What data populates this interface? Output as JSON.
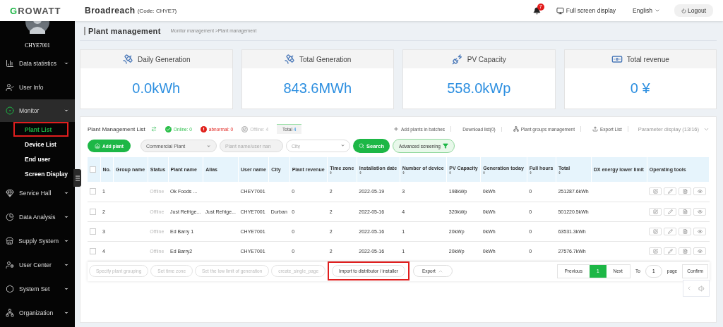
{
  "header": {
    "logo": "GROWATT",
    "org_name": "Broadreach",
    "org_code": "(Code:  CHYE7)",
    "notifications": "7",
    "fullscreen": "Full screen display",
    "language": "English",
    "logout": "Logout"
  },
  "sidebar": {
    "username": "CHYE7001",
    "items": [
      {
        "label": "Data statistics",
        "kind": "group",
        "expanded": false
      },
      {
        "label": "User Info",
        "kind": "link",
        "expanded": false
      },
      {
        "label": "Monitor",
        "kind": "group",
        "expanded": true,
        "children": [
          {
            "label": "Plant List",
            "selected": true,
            "highlighted": true
          },
          {
            "label": "Device List",
            "selected": false,
            "highlighted": false
          },
          {
            "label": "End user",
            "selected": false,
            "highlighted": false
          },
          {
            "label": "Screen Display",
            "selected": false,
            "highlighted": false
          }
        ]
      },
      {
        "label": "Service Hall",
        "kind": "group",
        "expanded": false
      },
      {
        "label": "Data Analysis",
        "kind": "group",
        "expanded": false
      },
      {
        "label": "Supply System",
        "kind": "group",
        "expanded": false
      },
      {
        "label": "User Center",
        "kind": "group",
        "expanded": false
      },
      {
        "label": "System Set",
        "kind": "group",
        "expanded": false
      },
      {
        "label": "Organization",
        "kind": "group",
        "expanded": false
      }
    ]
  },
  "breadcrumb": {
    "title": "Plant management",
    "path": "Monitor management >Plant management"
  },
  "stats": [
    {
      "label": "Daily Generation",
      "value": "0.0kWh"
    },
    {
      "label": "Total Generation",
      "value": "843.6MWh"
    },
    {
      "label": "PV Capacity",
      "value": "558.0kWp"
    },
    {
      "label": "Total revenue",
      "value": "0 ¥"
    }
  ],
  "list": {
    "title": "Plant Management List",
    "statuses": [
      {
        "label": "Online: 0",
        "color": "#2bbf4a"
      },
      {
        "label": "abnormal: 0",
        "color": "#e0201b"
      },
      {
        "label": "Offline: 4",
        "color": "#bdbdbd"
      }
    ],
    "total": {
      "label": "Total",
      "count": "4",
      "selected": true
    },
    "actions": [
      "Add plants in batches",
      "Download list(0)",
      "Plant groups management",
      "Export List"
    ],
    "parameter_display": "Parameter display  (13/16)"
  },
  "filters": {
    "add_button": "Add plant",
    "plant_type": "Commercial Plant",
    "search_placeholder": "Plant name/user nan",
    "city_placeholder": "City",
    "search_button": "Search",
    "advanced_button": "Advanced screening"
  },
  "table": {
    "select_all_checked": false,
    "columns": [
      {
        "label": "No.",
        "kind": "text",
        "sortable": false
      },
      {
        "label": "Group name",
        "kind": "text",
        "sortable": false
      },
      {
        "label": "Status",
        "kind": "status",
        "sortable": false
      },
      {
        "label": "Plant name",
        "kind": "text",
        "sortable": false
      },
      {
        "label": "Alias",
        "kind": "text",
        "sortable": false
      },
      {
        "label": "User name",
        "kind": "text",
        "sortable": false
      },
      {
        "label": "City",
        "kind": "text",
        "sortable": false
      },
      {
        "label": "Plant revenue",
        "kind": "text",
        "sortable": false
      },
      {
        "label": "Time zone",
        "kind": "text",
        "sortable": true
      },
      {
        "label": "Installation date",
        "kind": "text",
        "sortable": true
      },
      {
        "label": "Number of device",
        "kind": "text",
        "sortable": true
      },
      {
        "label": "PV Capacity",
        "kind": "text",
        "sortable": true
      },
      {
        "label": "Generation today",
        "kind": "text",
        "sortable": true
      },
      {
        "label": "Full hours",
        "kind": "text",
        "sortable": true
      },
      {
        "label": "Total",
        "kind": "text",
        "sortable": true
      },
      {
        "label": "DX energy lower limit",
        "kind": "text",
        "sortable": false
      },
      {
        "label": "Operating tools",
        "kind": "tools",
        "sortable": false
      }
    ],
    "rows": [
      {
        "checked": false,
        "cells": [
          "1",
          null,
          "Offline",
          "Ok Foods ...",
          null,
          "CHEY7001",
          null,
          "0",
          "2",
          "2022-05-19",
          "3",
          "198kWp",
          "0kWh",
          "0",
          "251287.6kWh",
          null,
          null
        ]
      },
      {
        "checked": false,
        "cells": [
          "2",
          null,
          "Offline",
          "Just Refrige...",
          "Just Refrige...",
          "CHYE7001",
          "Durban",
          "0",
          "2",
          "2022-05-16",
          "4",
          "320kWp",
          "0kWh",
          "0",
          "501220.5kWh",
          null,
          null
        ]
      },
      {
        "checked": false,
        "cells": [
          "3",
          null,
          "Offline",
          "Ed Barry 1",
          null,
          "CHYE7001",
          null,
          "0",
          "2",
          "2022-05-16",
          "1",
          "20kWp",
          "0kWh",
          "0",
          "63531.3kWh",
          null,
          null
        ]
      },
      {
        "checked": false,
        "cells": [
          "4",
          null,
          "Offline",
          "Ed Barry2",
          null,
          "CHYE7001",
          null,
          "0",
          "2",
          "2022-05-16",
          "1",
          "20kWp",
          "0kWh",
          "0",
          "27576.7kWh",
          null,
          null
        ]
      }
    ]
  },
  "batch_buttons": [
    {
      "label": "Specify plant grouping",
      "disabled": true,
      "highlighted": false
    },
    {
      "label": "Set time zone",
      "disabled": true,
      "highlighted": false
    },
    {
      "label": "Set the low limit of generation",
      "disabled": true,
      "highlighted": false
    },
    {
      "label": "create_single_page",
      "disabled": true,
      "highlighted": false
    },
    {
      "label": "Import to distributor / installer",
      "disabled": false,
      "highlighted": true
    }
  ],
  "export_button": "Export",
  "pagination": {
    "previous": "Previous",
    "pages": [
      {
        "label": "1",
        "selected": true
      }
    ],
    "next": "Next",
    "to": "To",
    "page_input": "1",
    "page": "page",
    "confirm": "Confirm"
  }
}
